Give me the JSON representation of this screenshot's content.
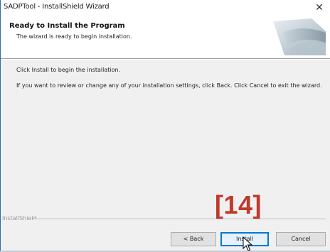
{
  "window": {
    "title": "SADPTool - InstallShield Wizard",
    "close_glyph": "✕"
  },
  "banner": {
    "title": "Ready to Install the Program",
    "subtitle": "The wizard is ready to begin installation."
  },
  "content": {
    "paragraph1": "Click Install to begin the installation.",
    "paragraph2": "If you want to review or change any of your installation settings, click Back. Click Cancel to exit the wizard."
  },
  "footer": {
    "brand": "InstallShield"
  },
  "buttons": {
    "back": "< Back",
    "install": "Install",
    "cancel": "Cancel"
  },
  "annotation": {
    "label": "[14]",
    "color": "#c0392b"
  },
  "icons": {
    "close": "close-icon",
    "banner": "installshield-banner-graphic",
    "cursor": "mouse-pointer-icon"
  }
}
